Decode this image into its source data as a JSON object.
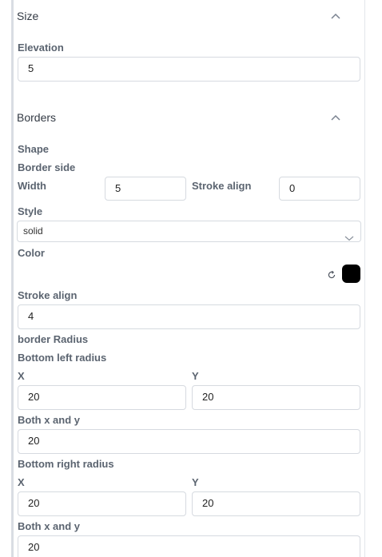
{
  "size": {
    "title": "Size",
    "elevation_label": "Elevation",
    "elevation_value": "5"
  },
  "borders": {
    "title": "Borders",
    "shape_label": "Shape",
    "border_side_label": "Border side",
    "width_label": "Width",
    "width_value": "5",
    "stroke_align_label": "Stroke align",
    "stroke_align_value": "0",
    "style_label": "Style",
    "style_value": "solid",
    "color_label": "Color",
    "color_value": "#000000",
    "stroke_align2_label": "Stroke align",
    "stroke_align2_value": "4"
  },
  "radius": {
    "title": "border Radius",
    "bottom_left": {
      "label": "Bottom left radius",
      "x_label": "X",
      "x_value": "20",
      "y_label": "Y",
      "y_value": "20",
      "both_label": "Both x and y",
      "both_value": "20"
    },
    "bottom_right": {
      "label": "Bottom right radius",
      "x_label": "X",
      "x_value": "20",
      "y_label": "Y",
      "y_value": "20",
      "both_label": "Both x and y",
      "both_value": "20"
    }
  },
  "icons": {
    "collapse": "chevron-up-icon",
    "dropdown": "chevron-down-icon",
    "reset": "reset-icon"
  }
}
